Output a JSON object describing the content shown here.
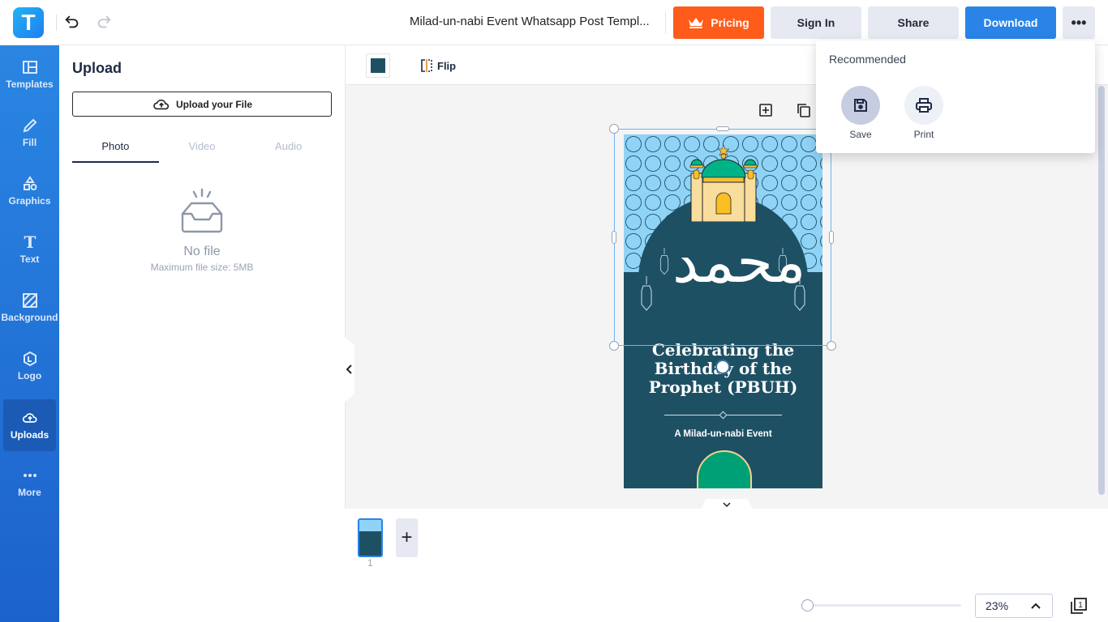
{
  "header": {
    "logo_letter": "T",
    "document_title": "Milad-un-nabi Event Whatsapp Post Templ...",
    "buttons": {
      "pricing": "Pricing",
      "sign_in": "Sign In",
      "share": "Share",
      "download": "Download",
      "more": "•••"
    }
  },
  "sidebar": {
    "items": [
      {
        "label": "Templates",
        "icon": "templates-icon"
      },
      {
        "label": "Fill",
        "icon": "pencil-icon"
      },
      {
        "label": "Graphics",
        "icon": "shapes-icon"
      },
      {
        "label": "Text",
        "icon": "text-icon"
      },
      {
        "label": "Background",
        "icon": "background-icon"
      },
      {
        "label": "Logo",
        "icon": "logo-icon"
      },
      {
        "label": "Uploads",
        "icon": "cloud-upload-icon",
        "active": true
      },
      {
        "label": "More",
        "icon": "more-dots-icon"
      }
    ]
  },
  "upload_panel": {
    "title": "Upload",
    "upload_button": "Upload your File",
    "tabs": [
      {
        "label": "Photo",
        "active": true
      },
      {
        "label": "Video",
        "active": false
      },
      {
        "label": "Audio",
        "active": false
      }
    ],
    "empty_title": "No file",
    "empty_subtitle": "Maximum file size: 5MB"
  },
  "toolbar": {
    "fill_color": "#1e5064",
    "flip_label": "Flip"
  },
  "design": {
    "calligraphy": "محمد",
    "headline_lines": [
      "Celebrating the",
      "Birthday of the",
      "Prophet (PBUH)"
    ],
    "subline": "A Milad-un-nabi Event",
    "colors": {
      "background": "#1e5064",
      "pattern": "#8fd3f7",
      "dome": "#00b386",
      "building": "#f9dd9c",
      "door": "#fbbf24"
    }
  },
  "pages": {
    "thumbnails": [
      {
        "number": "1",
        "selected": true
      }
    ],
    "add_label": "+"
  },
  "zoom": {
    "value": "23%",
    "page_count": "1"
  },
  "dropdown": {
    "title": "Recommended",
    "items": [
      {
        "label": "Save",
        "icon": "save-icon"
      },
      {
        "label": "Print",
        "icon": "print-icon"
      }
    ]
  },
  "accent_colors": {
    "pricing": "#ff5b1a",
    "primary": "#2a84e8",
    "sidebar_top": "#2a86e2",
    "sidebar_bottom": "#1c62cc"
  }
}
